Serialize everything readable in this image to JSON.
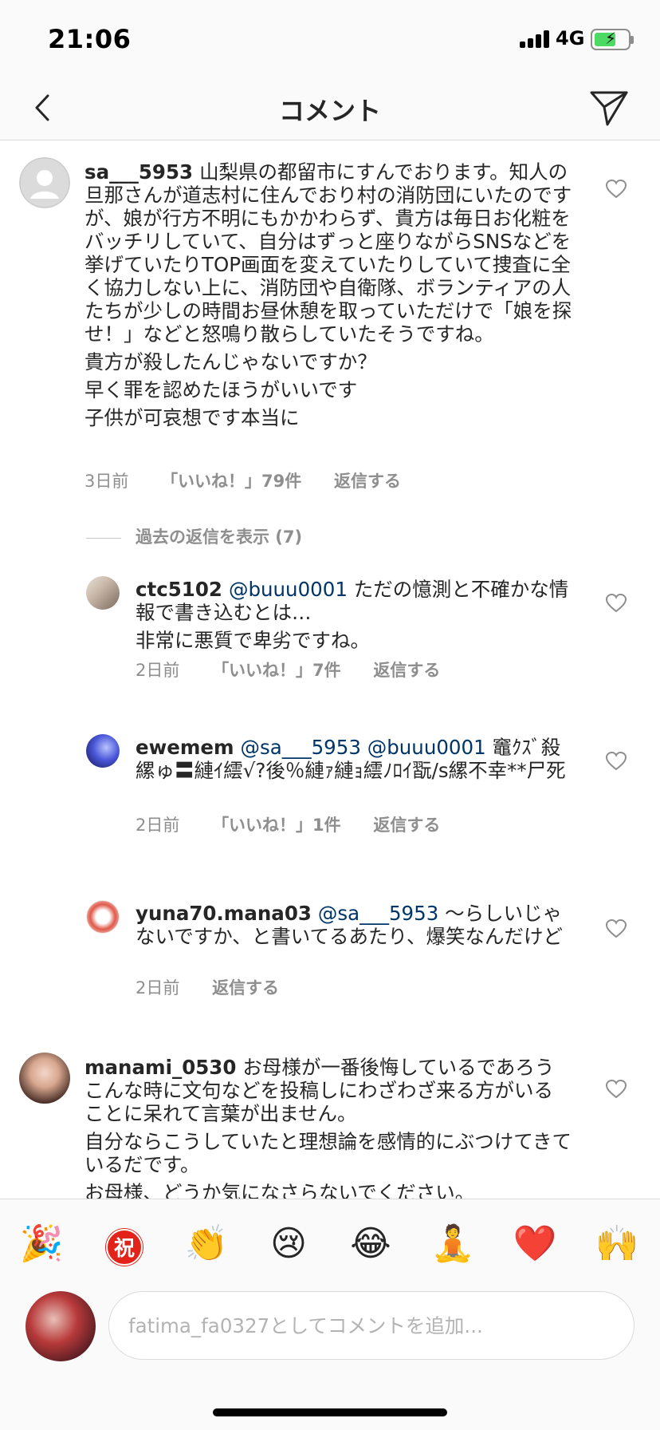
{
  "status": {
    "time": "21:06",
    "network": "4G"
  },
  "nav": {
    "title": "コメント"
  },
  "main_comment": {
    "username": "sa___5953",
    "paragraphs": [
      "山梨県の都留市にすんでおります。知人の旦那さんが道志村に住んでおり村の消防団にいたのですが、娘が行方不明にもかかわらず、貴方は毎日お化粧をバッチリしていて、自分はずっと座りながらSNSなどを挙げていたりTOP画面を変えていたりしていて捜査に全く協力しない上に、消防団や自衛隊、ボランティアの人たちが少しの時間お昼休憩を取っていただけで「娘を探せ！」などと怒鳴り散らしていたそうですね。",
      "貴方が殺したんじゃないですか？",
      "早く罪を認めたほうがいいです",
      "子供が可哀想です本当に"
    ],
    "time": "3日前",
    "likes": "「いいね！」79件",
    "reply": "返信する"
  },
  "view_replies": "過去の返信を表示 (7)",
  "replies": [
    {
      "username": "ctc5102",
      "mention": "@buuu0001",
      "text1": "ただの憶測と不確かな情報で書き込むとは…",
      "text2": "非常に悪質で卑劣ですね。",
      "time": "2日前",
      "likes": "「いいね！」7件",
      "reply": "返信する"
    },
    {
      "username": "ewemem",
      "mention": "@sa___5953 @buuu0001",
      "text1": "竈ｸｽﾞ殺縲ゅ〓縺ｲ繧√?後％縺ｧ縺ｮ繧ﾉﾛｲ翫/s縲不幸**尸死",
      "time": "2日前",
      "likes": "「いいね！」1件",
      "reply": "返信する"
    },
    {
      "username": "yuna70.mana03",
      "mention": "@sa___5953",
      "text1": "～らしいじゃないですか、と書いてるあたり、爆笑なんだけど",
      "time": "2日前",
      "reply": "返信する"
    }
  ],
  "second_comment": {
    "username": "manami_0530",
    "paragraphs": [
      "お母様が一番後悔しているであろうこんな時に文句などを投稿しにわざわざ来る方がいることに呆れて言葉が出ません。",
      "自分ならこうしていたと理想論を感情的にぶつけてきているだです。",
      "お母様、どうか気になさらないでください。"
    ]
  },
  "emoji_bar": [
    "🎉",
    "祝",
    "👏",
    "😢",
    "😂",
    "🧘",
    "❤️",
    "🙌"
  ],
  "input": {
    "placeholder": "fatima_fa0327としてコメントを追加..."
  },
  "colors": {
    "text": "#262626",
    "meta": "#8e8e8e",
    "mention": "#003569",
    "border": "#dbdbdb"
  }
}
